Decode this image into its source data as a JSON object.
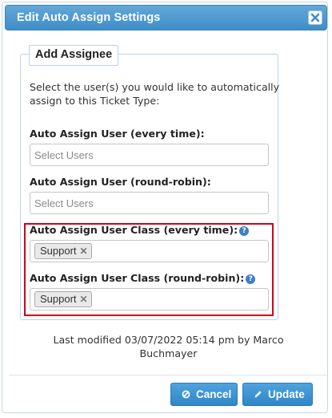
{
  "dialog": {
    "title": "Edit Auto Assign Settings",
    "close_icon": "close-x-icon"
  },
  "section": {
    "legend": "Add Assignee",
    "intro": "Select the user(s) you would like to automatically assign to this Ticket Type:"
  },
  "fields": {
    "user_every_time": {
      "label": "Auto Assign User (every time):",
      "placeholder": "Select Users"
    },
    "user_round_robin": {
      "label": "Auto Assign User (round-robin):",
      "placeholder": "Select Users"
    },
    "class_every_time": {
      "label": "Auto Assign User Class (every time):",
      "tags": [
        "Support"
      ],
      "help_icon": "question-mark-icon"
    },
    "class_round_robin": {
      "label": "Auto Assign User Class (round-robin):",
      "tags": [
        "Support"
      ],
      "help_icon": "question-mark-icon"
    }
  },
  "tag_remove_symbol": "✕",
  "last_modified": "Last modified 03/07/2022 05:14 pm by Marco Buchmayer",
  "buttons": {
    "cancel": {
      "label": "Cancel",
      "icon": "cancel-circle-icon"
    },
    "update": {
      "label": "Update",
      "icon": "pencil-icon"
    }
  },
  "colors": {
    "titlebar": "#4a98d0",
    "button": "#3c93d2",
    "highlight_border": "#d0001f",
    "help_icon": "#3c7fc6"
  }
}
